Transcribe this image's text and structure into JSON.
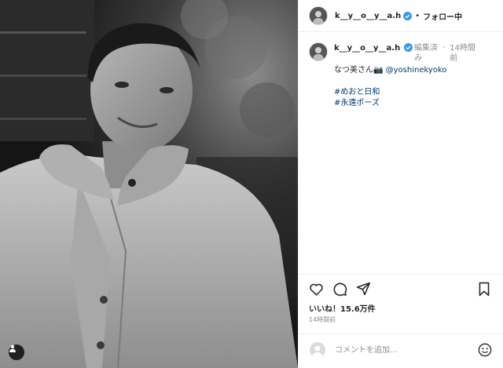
{
  "post": {
    "header": {
      "username": "k__y__o__y__a.h",
      "verified_icon": "verified-badge-icon",
      "separator": "•",
      "follow_label": "フォロー中"
    },
    "caption": {
      "username": "k__y__o__y__a.h",
      "edited": "編集済み",
      "separator": "·",
      "time": "14時間前",
      "text": "なつ美さん📷 ",
      "mention": "@yoshinekyoko",
      "hashtags": [
        "#めおと日和",
        "#永遠ポーズ"
      ]
    },
    "actions": {
      "icons": [
        "heart-icon",
        "comment-icon",
        "share-icon",
        "bookmark-icon"
      ],
      "likes": "いいね！15.6万件",
      "time": "14時間前"
    },
    "comment": {
      "placeholder": "コメントを追加...",
      "emoji_icon": "smiley-icon"
    },
    "colors": {
      "text": "#262626",
      "muted": "#8e8e8e",
      "link": "#00376b",
      "verified": "#3897f0",
      "border": "#efefef"
    }
  }
}
